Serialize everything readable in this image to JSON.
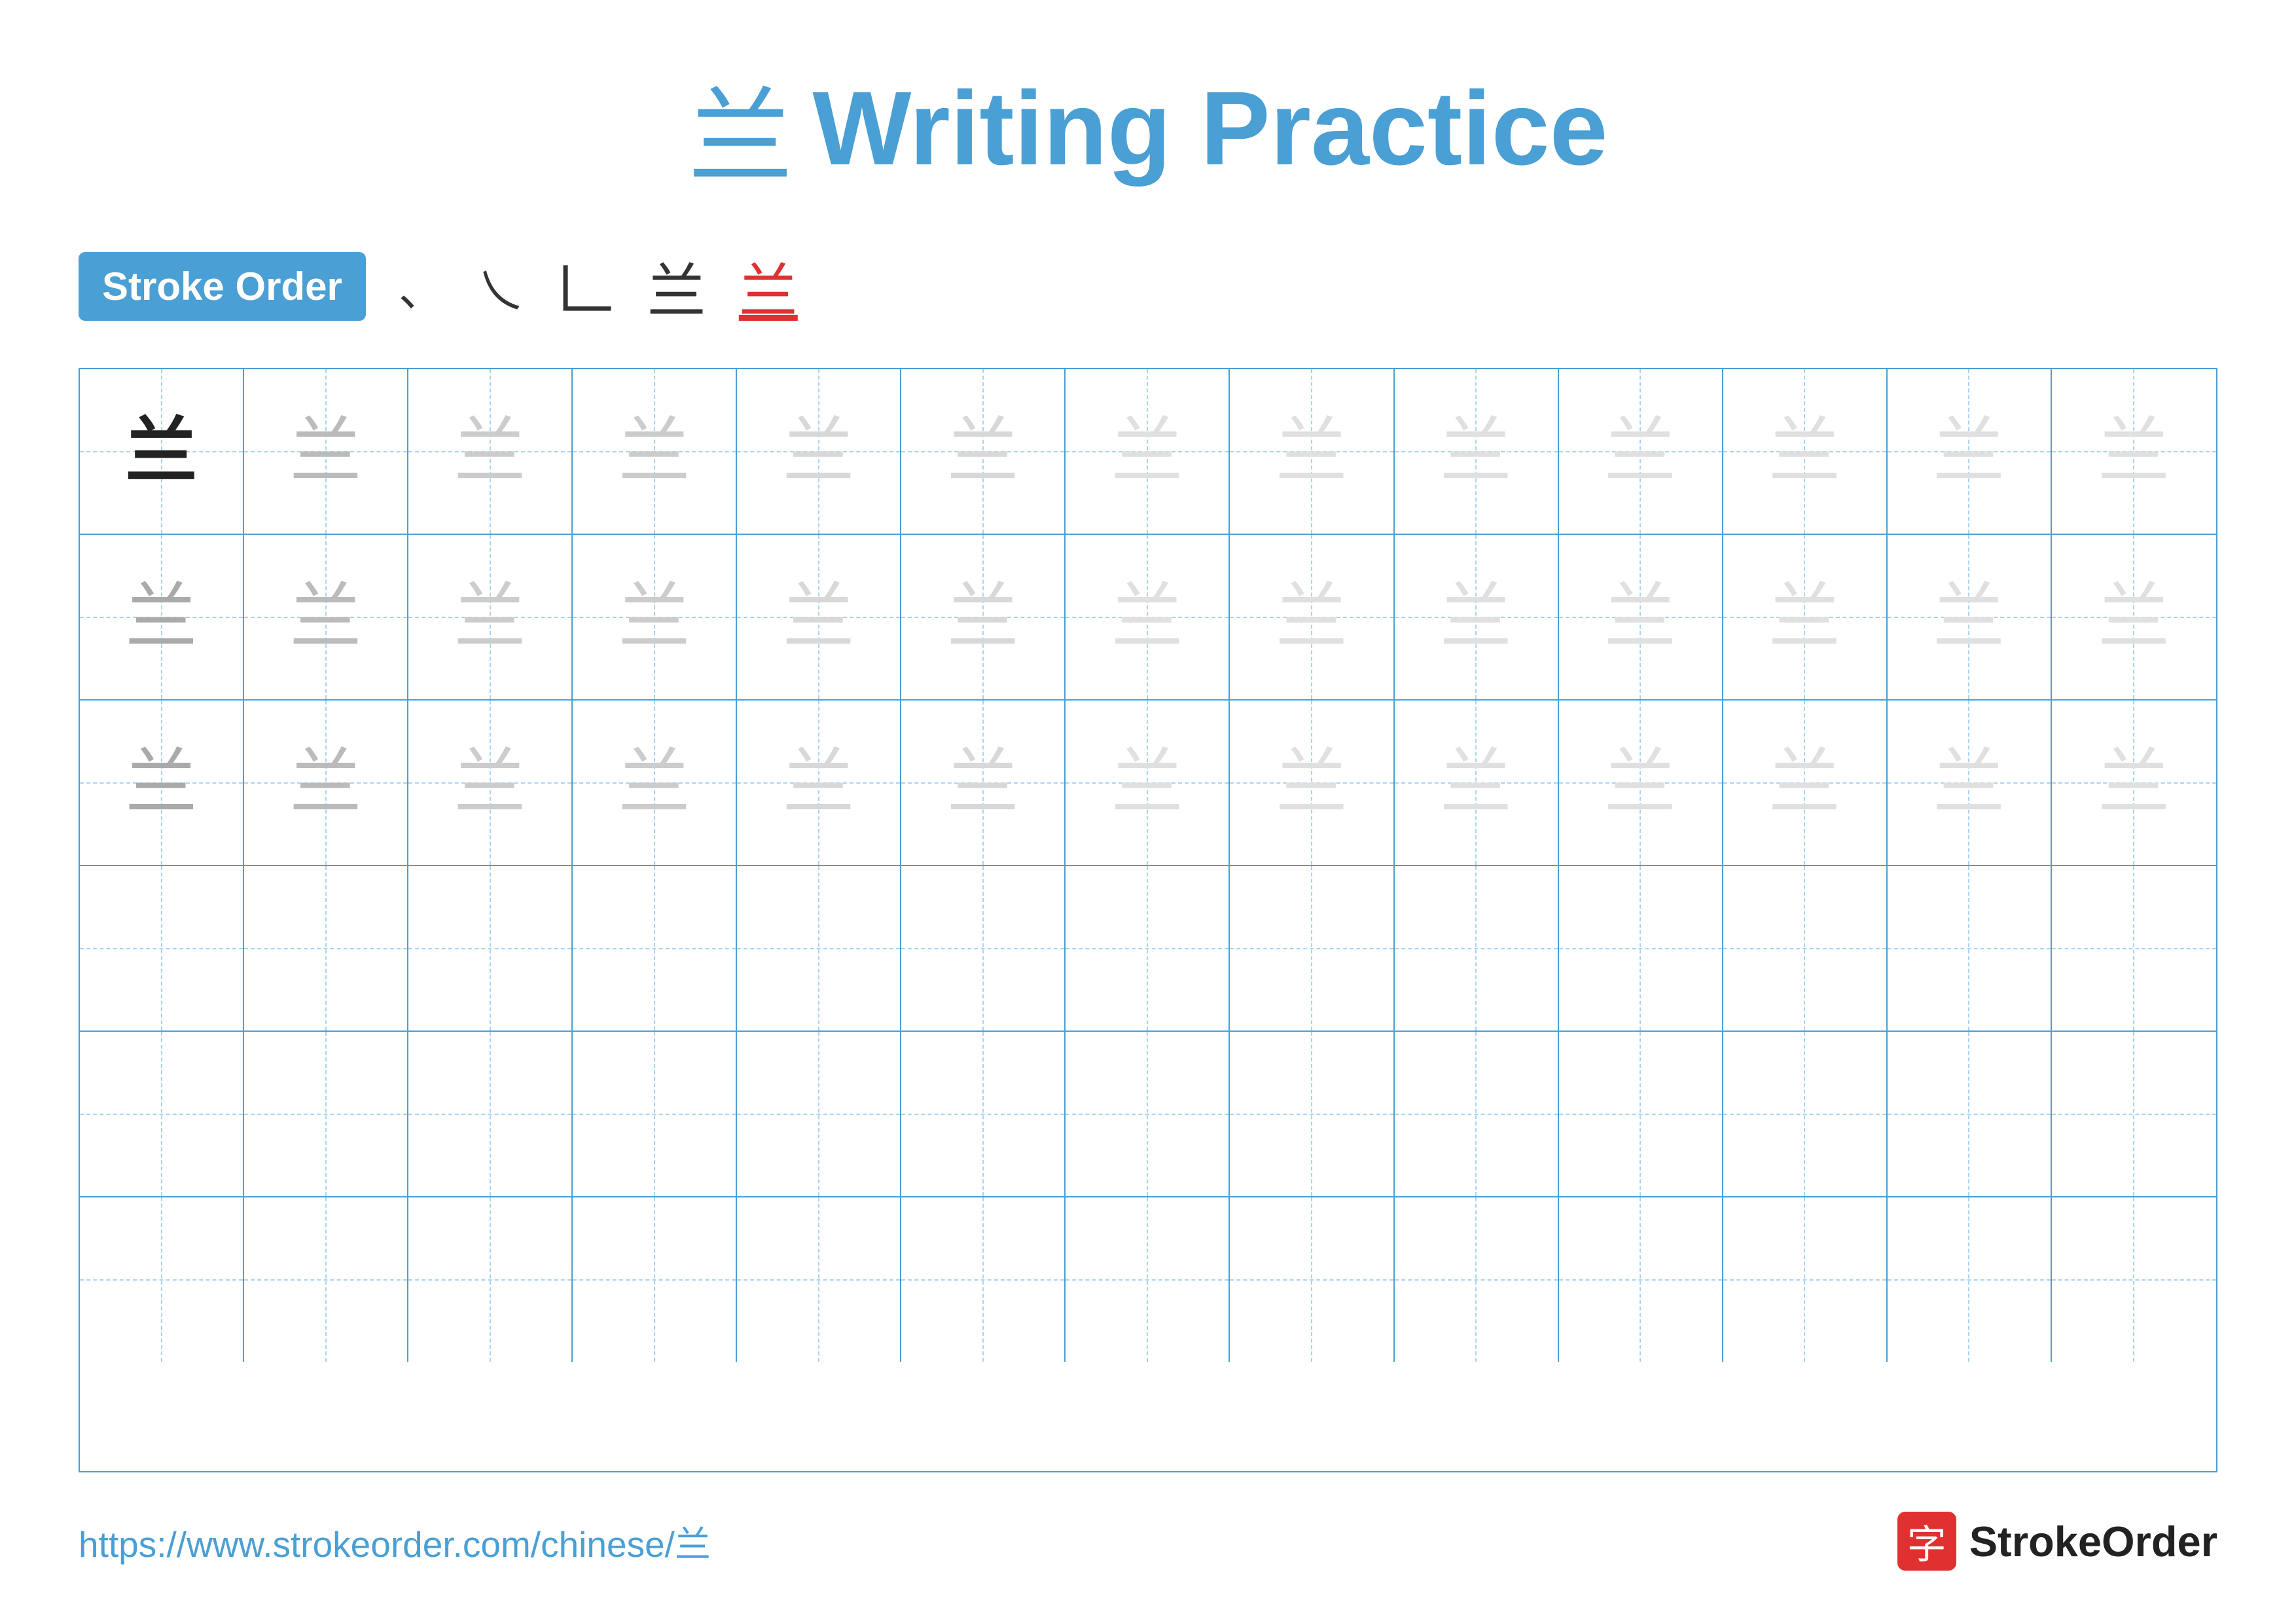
{
  "title": {
    "char": "兰",
    "text": "Writing Practice"
  },
  "stroke_order": {
    "badge_label": "Stroke Order",
    "steps": [
      "、",
      "乀",
      "𠃊",
      "兰",
      "兰"
    ]
  },
  "grid": {
    "rows": 6,
    "cols": 13,
    "char": "兰"
  },
  "footer": {
    "url": "https://www.strokeorder.com/chinese/兰",
    "logo_char": "字",
    "logo_text": "StrokeOrder"
  }
}
